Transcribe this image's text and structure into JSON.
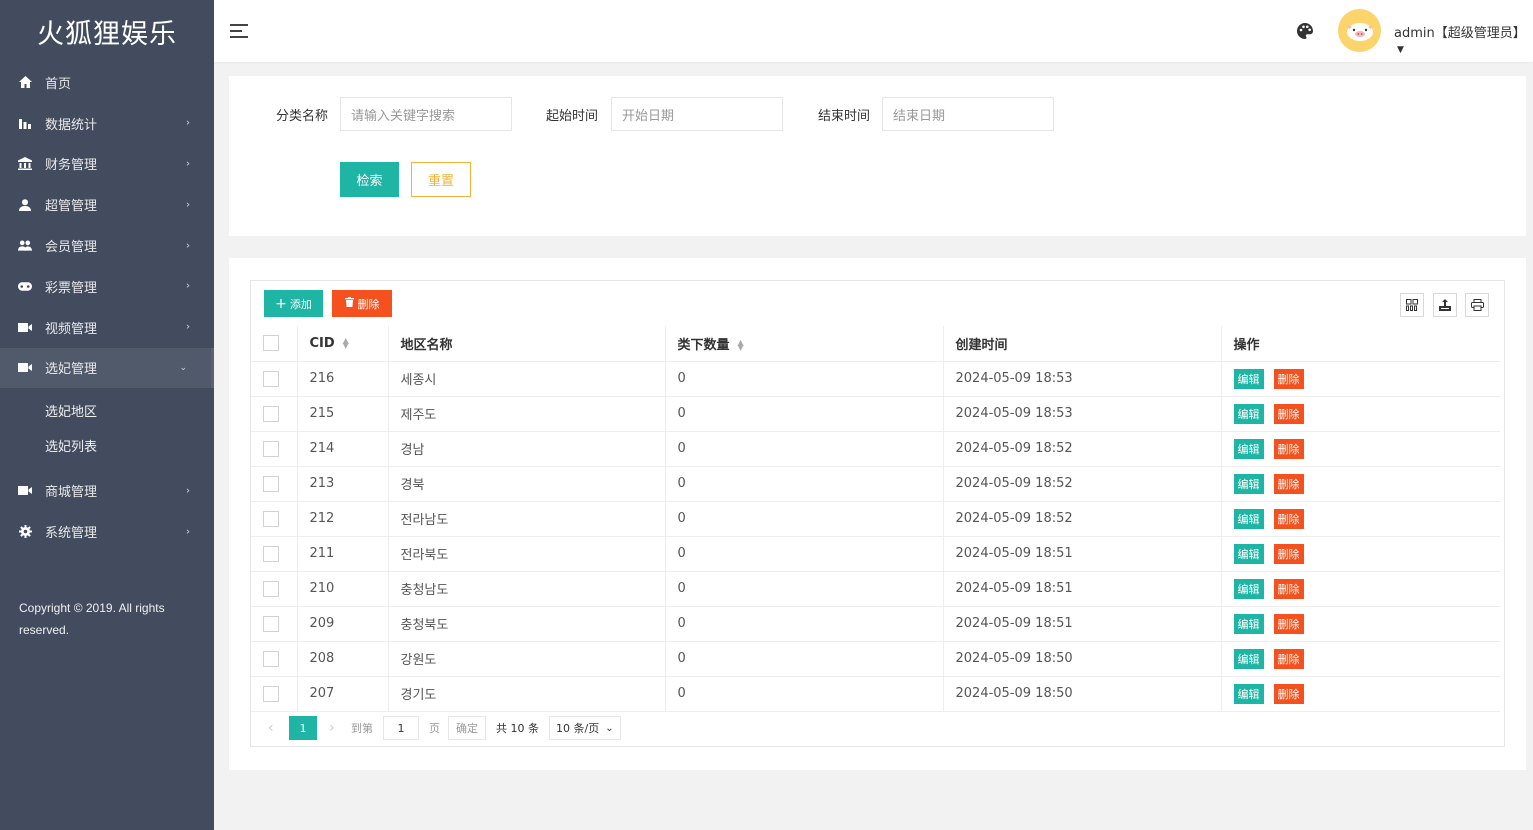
{
  "app": {
    "title": "火狐狸娱乐"
  },
  "sidebar": {
    "items": [
      {
        "label": "首页",
        "icon": "home-icon"
      },
      {
        "label": "数据统计",
        "icon": "bar-chart-icon"
      },
      {
        "label": "财务管理",
        "icon": "bank-icon"
      },
      {
        "label": "超管管理",
        "icon": "user-icon"
      },
      {
        "label": "会员管理",
        "icon": "users-icon"
      },
      {
        "label": "彩票管理",
        "icon": "gamepad-icon"
      },
      {
        "label": "视频管理",
        "icon": "video-icon"
      },
      {
        "label": "选妃管理",
        "icon": "video-icon"
      },
      {
        "label": "商城管理",
        "icon": "video-icon"
      },
      {
        "label": "系统管理",
        "icon": "gear-icon"
      }
    ],
    "submenu": [
      {
        "label": "选妃地区"
      },
      {
        "label": "选妃列表"
      }
    ],
    "copyright": "Copyright © 2019. All rights reserved."
  },
  "header": {
    "username": "admin【超级管理员】"
  },
  "search": {
    "category_label": "分类名称",
    "category_placeholder": "请输入关键字搜索",
    "start_label": "起始时间",
    "start_placeholder": "开始日期",
    "end_label": "结束时间",
    "end_placeholder": "结束日期",
    "search_btn": "检索",
    "reset_btn": "重置"
  },
  "toolbar": {
    "add_label": "添加",
    "delete_label": "删除"
  },
  "table": {
    "columns": [
      "CID",
      "地区名称",
      "类下数量",
      "创建时间",
      "操作"
    ],
    "edit_label": "编辑",
    "delete_label": "删除",
    "rows": [
      {
        "cid": "216",
        "name": "세종시",
        "count": "0",
        "created": "2024-05-09 18:53"
      },
      {
        "cid": "215",
        "name": "제주도",
        "count": "0",
        "created": "2024-05-09 18:53"
      },
      {
        "cid": "214",
        "name": "경남",
        "count": "0",
        "created": "2024-05-09 18:52"
      },
      {
        "cid": "213",
        "name": "경북",
        "count": "0",
        "created": "2024-05-09 18:52"
      },
      {
        "cid": "212",
        "name": "전라남도",
        "count": "0",
        "created": "2024-05-09 18:52"
      },
      {
        "cid": "211",
        "name": "전라북도",
        "count": "0",
        "created": "2024-05-09 18:51"
      },
      {
        "cid": "210",
        "name": "충청남도",
        "count": "0",
        "created": "2024-05-09 18:51"
      },
      {
        "cid": "209",
        "name": "충청북도",
        "count": "0",
        "created": "2024-05-09 18:51"
      },
      {
        "cid": "208",
        "name": "강원도",
        "count": "0",
        "created": "2024-05-09 18:50"
      },
      {
        "cid": "207",
        "name": "경기도",
        "count": "0",
        "created": "2024-05-09 18:50"
      }
    ]
  },
  "pagination": {
    "current": "1",
    "goto_label": "到第",
    "goto_value": "1",
    "page_label": "页",
    "confirm_label": "确定",
    "total_label": "共 10 条",
    "size_label": "10 条/页"
  },
  "colors": {
    "sidebar_bg": "#434c5e",
    "primary": "#1fb5a4",
    "danger": "#f4511e",
    "warning": "#f4b23a"
  }
}
